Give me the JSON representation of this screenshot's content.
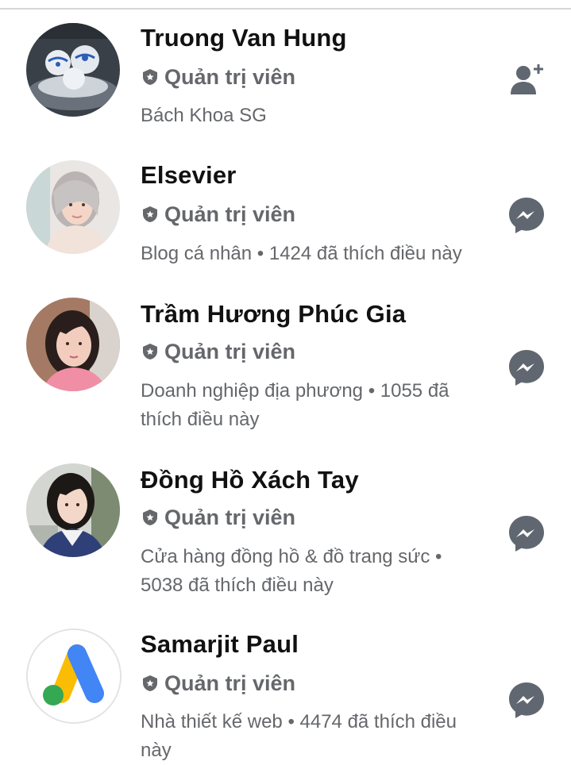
{
  "admin_role_label": "Quản trị viên",
  "colors": {
    "text_primary": "#111111",
    "text_secondary": "#65676b",
    "icon_gray": "#606770",
    "divider": "#d6d6d6"
  },
  "members": [
    {
      "name": "Truong Van Hung",
      "role": "Quản trị viên",
      "subtitle": "Bách Khoa SG",
      "action_icon": "add-friend-icon"
    },
    {
      "name": "Elsevier",
      "role": "Quản trị viên",
      "subtitle": "Blog cá nhân • 1424 đã thích điều này",
      "action_icon": "messenger-icon"
    },
    {
      "name": "Trầm Hương Phúc Gia",
      "role": "Quản trị viên",
      "subtitle": "Doanh nghiệp địa phương • 1055 đã thích điều này",
      "action_icon": "messenger-icon"
    },
    {
      "name": "Đồng Hồ Xách Tay",
      "role": "Quản trị viên",
      "subtitle": "Cửa hàng đồng hồ & đồ trang sức • 5038 đã thích điều này",
      "action_icon": "messenger-icon"
    },
    {
      "name": "Samarjit Paul",
      "role": "Quản trị viên",
      "subtitle": "Nhà thiết kế web • 4474 đã thích điều này",
      "action_icon": "messenger-icon"
    }
  ]
}
